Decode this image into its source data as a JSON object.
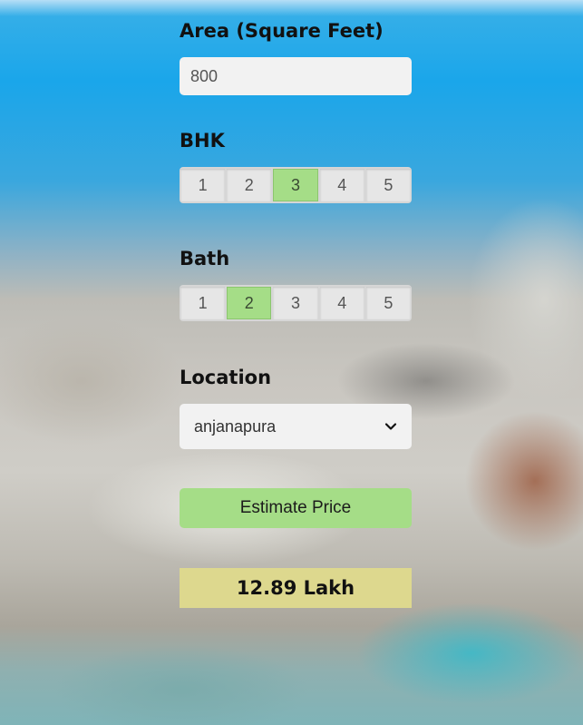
{
  "area": {
    "label": "Area (Square Feet)",
    "value": "800"
  },
  "bhk": {
    "label": "BHK",
    "options": [
      "1",
      "2",
      "3",
      "4",
      "5"
    ],
    "selected": "3"
  },
  "bath": {
    "label": "Bath",
    "options": [
      "1",
      "2",
      "3",
      "4",
      "5"
    ],
    "selected": "2"
  },
  "location": {
    "label": "Location",
    "selected": "anjanapura"
  },
  "estimate_button": {
    "label": "Estimate Price"
  },
  "result": {
    "text": "12.89 Lakh"
  },
  "colors": {
    "selected_option": "#a5dd87",
    "button": "#a5dd87",
    "result_background": "#ddd88e"
  },
  "icons": {
    "location_dropdown": "chevron-down-icon"
  }
}
